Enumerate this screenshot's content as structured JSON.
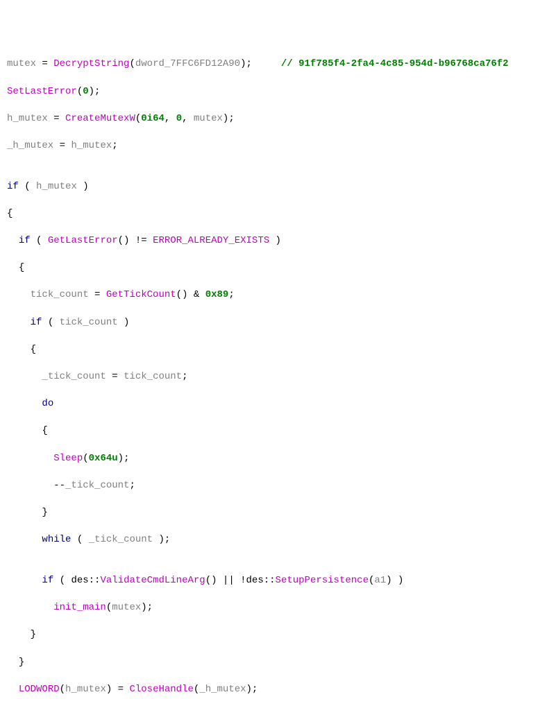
{
  "l1": {
    "v1": "mutex",
    "eq": " = ",
    "fn": "DecryptString",
    "lp": "(",
    "a1": "dword_7FFC6FD12A90",
    "rp": ")",
    "semi": ";",
    "pad": "     ",
    "comment": "// 91f785f4-2fa4-4c85-954d-b96768ca76f2"
  },
  "l2": {
    "fn": "SetLastError",
    "lp": "(",
    "a": "0",
    "rp": ")",
    "semi": ";"
  },
  "l3": {
    "v": "h_mutex",
    "eq": " = ",
    "fn": "CreateMutexW",
    "lp": "(",
    "a1": "0i64",
    "c1": ", ",
    "a2": "0",
    "c2": ", ",
    "a3": "mutex",
    "rp": ")",
    "semi": ";"
  },
  "l4": {
    "v1": "_h_mutex",
    "eq": " = ",
    "v2": "h_mutex",
    "semi": ";"
  },
  "l6": {
    "kw": "if",
    "sp": " ",
    "lp": "( ",
    "v": "h_mutex",
    "rp": " )"
  },
  "l7": {
    "b": "{"
  },
  "l8": {
    "ind": "  ",
    "kw": "if",
    "sp": " ",
    "lp": "( ",
    "fn": "GetLastError",
    "lp2": "()",
    "op": " != ",
    "c": "ERROR_ALREADY_EXISTS",
    "rp": " )"
  },
  "l9": {
    "ind": "  ",
    "b": "{"
  },
  "l10": {
    "ind": "    ",
    "v": "tick_count",
    "eq": " = ",
    "fn": "GetTickCount",
    "lp": "()",
    "op": " & ",
    "n": "0x89",
    "semi": ";"
  },
  "l11": {
    "ind": "    ",
    "kw": "if",
    "sp": " ",
    "lp": "( ",
    "v": "tick_count",
    "rp": " )"
  },
  "l12": {
    "ind": "    ",
    "b": "{"
  },
  "l13": {
    "ind": "      ",
    "v1": "_tick_count",
    "eq": " = ",
    "v2": "tick_count",
    "semi": ";"
  },
  "l14": {
    "ind": "      ",
    "kw": "do"
  },
  "l15": {
    "ind": "      ",
    "b": "{"
  },
  "l16": {
    "ind": "        ",
    "fn": "Sleep",
    "lp": "(",
    "a": "0x64u",
    "rp": ")",
    "semi": ";"
  },
  "l17": {
    "ind": "        ",
    "op": "--",
    "v": "_tick_count",
    "semi": ";"
  },
  "l18": {
    "ind": "      ",
    "b": "}"
  },
  "l19": {
    "ind": "      ",
    "kw": "while",
    "sp": " ",
    "lp": "( ",
    "v": "_tick_count",
    "rp": " )",
    "semi": ";"
  },
  "l21": {
    "ind": "      ",
    "kw": "if",
    "sp": " ",
    "lp": "( ",
    "ns": "des::",
    "fn1": "ValidateCmdLineArg",
    "p1": "()",
    "op": " || ",
    "neg": "!",
    "ns2": "des::",
    "fn2": "SetupPersistence",
    "lp2": "(",
    "a": "a1",
    "rp2": ")",
    "rp": " )"
  },
  "l22": {
    "ind": "        ",
    "fn": "init_main",
    "lp": "(",
    "a": "mutex",
    "rp": ")",
    "semi": ";"
  },
  "l23": {
    "ind": "    ",
    "b": "}"
  },
  "l24": {
    "ind": "  ",
    "b": "}"
  },
  "l25": {
    "ind": "  ",
    "fn1": "LODWORD",
    "lp1": "(",
    "a1": "h_mutex",
    "rp1": ")",
    "eq": " = ",
    "fn2": "CloseHandle",
    "lp2": "(",
    "a2": "_h_mutex",
    "rp2": ")",
    "semi": ";"
  }
}
